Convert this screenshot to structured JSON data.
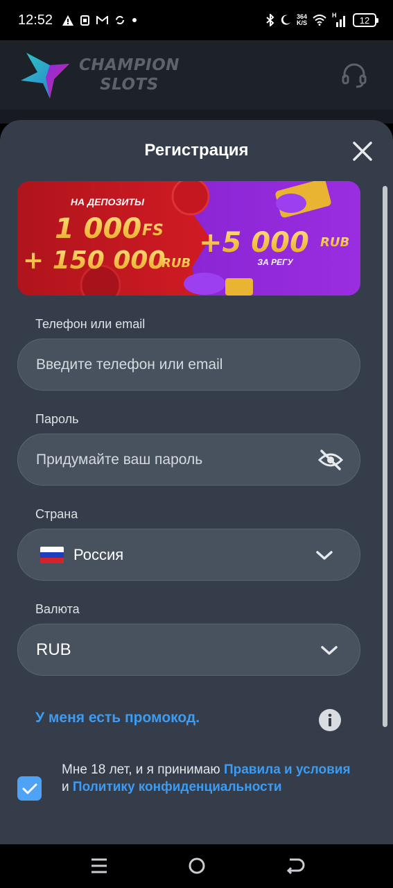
{
  "status_bar": {
    "time": "12:52",
    "speed_value": "364",
    "speed_unit": "K/S",
    "network": "H",
    "battery": "12",
    "icons": [
      "warning-icon",
      "sim-icon",
      "gmail-icon",
      "sync-icon",
      "dot-icon",
      "bluetooth-icon",
      "moon-icon",
      "wifi-icon",
      "signal-icon"
    ]
  },
  "header": {
    "logo_line1": "CHAMPION",
    "logo_line2": "SLOTS",
    "support_icon": "headset-icon"
  },
  "modal": {
    "title": "Регистрация",
    "close_icon": "close-icon"
  },
  "banner": {
    "deposit_label": "НА ДЕПОЗИТЫ",
    "fs_amount": "1 000",
    "fs_unit": "FS",
    "rub_amount": "+ 150 000",
    "rub_unit": "RUB",
    "reg_amount": "+5 000",
    "reg_unit": "RUB",
    "reg_label": "ЗА РЕГУ"
  },
  "form": {
    "phone_label": "Телефон или email",
    "phone_placeholder": "Введите телефон или email",
    "password_label": "Пароль",
    "password_placeholder": "Придумайте ваш пароль",
    "country_label": "Страна",
    "country_value": "Россия",
    "currency_label": "Валюта",
    "currency_value": "RUB",
    "promo_link": "У меня есть промокод.",
    "terms_prefix": "Мне 18 лет, и я принимаю ",
    "terms_link1": "Правила и условия",
    "terms_middle": " и ",
    "terms_link2": "Политику конфиденциальности",
    "agree_checked": true
  },
  "colors": {
    "accent": "#3d9bf2",
    "modal_bg": "#343d49",
    "field_bg": "#48525f",
    "header_bg": "#1d2229"
  }
}
